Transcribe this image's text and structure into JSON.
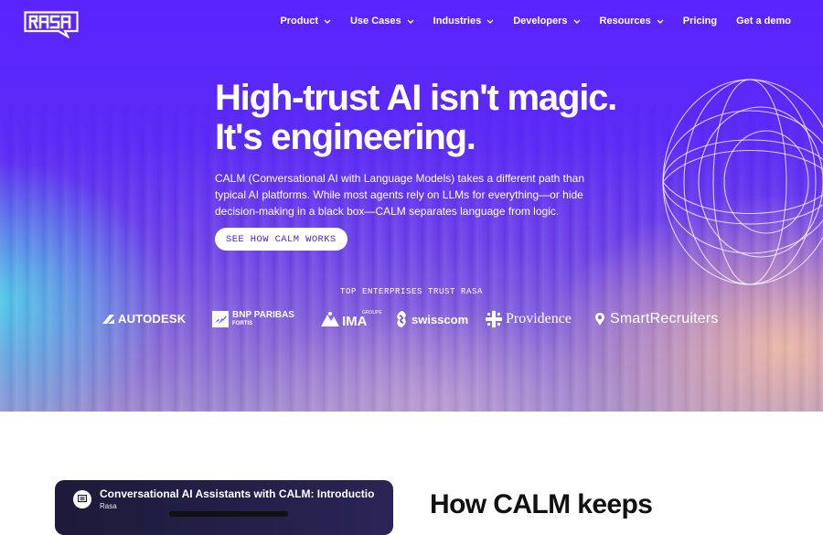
{
  "header": {
    "logo_text": "RASA",
    "nav": [
      {
        "label": "Product",
        "has_dropdown": true
      },
      {
        "label": "Use Cases",
        "has_dropdown": true
      },
      {
        "label": "Industries",
        "has_dropdown": true
      },
      {
        "label": "Developers",
        "has_dropdown": true
      },
      {
        "label": "Resources",
        "has_dropdown": true
      },
      {
        "label": "Pricing",
        "has_dropdown": false
      },
      {
        "label": "Get a demo",
        "has_dropdown": false
      }
    ]
  },
  "hero": {
    "headline_line1": "High-trust AI isn't magic.",
    "headline_line2": "It's engineering.",
    "lede": "CALM (Conversational AI with Language Models) takes a different path than typical AI platforms. While most agents rely on LLMs for everything—or hide decision-making in a black box—CALM separates language from logic.",
    "cta_label": "SEE HOW CALM WORKS"
  },
  "trust": {
    "label": "TOP ENTERPRISES TRUST RASA",
    "logos": [
      {
        "name": "AUTODESK",
        "icon": "autodesk-logo-icon"
      },
      {
        "name": "BNP PARIBAS",
        "sub": "FORTIS",
        "icon": "bnp-paribas-logo-icon"
      },
      {
        "name": "IMA",
        "sub": "GROUPE",
        "icon": "ima-logo-icon"
      },
      {
        "name": "swisscom",
        "icon": "swisscom-logo-icon"
      },
      {
        "name": "Providence",
        "icon": "providence-logo-icon"
      },
      {
        "name": "SmartRecruiters",
        "icon": "smartrecruiters-logo-icon"
      }
    ]
  },
  "video": {
    "title": "Conversational AI Assistants with CALM: Introduction",
    "channel": "Rasa"
  },
  "section": {
    "title": "How CALM keeps"
  },
  "colors": {
    "hero_purple": "#5a24ff",
    "cta_text": "#4b1fd8",
    "accent_cyan": "#46dceb",
    "accent_peach": "#f5bea0"
  }
}
